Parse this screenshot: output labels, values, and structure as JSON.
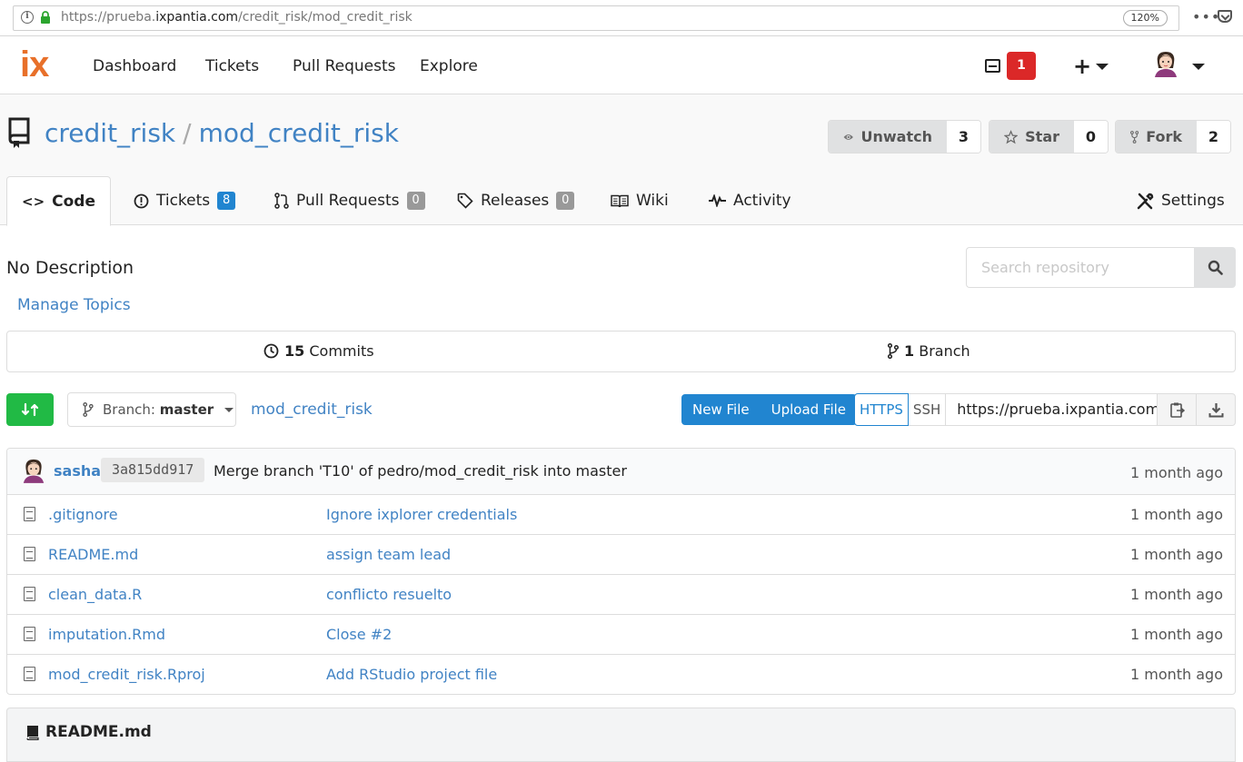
{
  "browser": {
    "url_prefix": "https://prueba.",
    "url_host": "ixpantia.com",
    "url_path": "/credit_risk/mod_credit_risk",
    "zoom": "120%"
  },
  "navbar": {
    "logo": "ix",
    "items": [
      "Dashboard",
      "Tickets",
      "Pull Requests",
      "Explore"
    ],
    "notifications": "1"
  },
  "repo": {
    "owner": "credit_risk",
    "separator": "/",
    "name": "mod_credit_risk",
    "watch_label": "Unwatch",
    "watch_count": "3",
    "star_label": "Star",
    "star_count": "0",
    "fork_label": "Fork",
    "fork_count": "2"
  },
  "tabs": {
    "code": "Code",
    "tickets": "Tickets",
    "tickets_count": "8",
    "pulls": "Pull Requests",
    "pulls_count": "0",
    "releases": "Releases",
    "releases_count": "0",
    "wiki": "Wiki",
    "activity": "Activity",
    "settings": "Settings"
  },
  "description": "No Description",
  "manage_topics": "Manage Topics",
  "search": {
    "placeholder": "Search repository"
  },
  "stats": {
    "commits_count": "15",
    "commits_label": "Commits",
    "branch_count": "1",
    "branch_label": "Branch"
  },
  "branch_bar": {
    "branch_prefix": "Branch:",
    "branch": "master",
    "breadcrumb": "mod_credit_risk",
    "new_file": "New File",
    "upload_file": "Upload File",
    "https": "HTTPS",
    "ssh": "SSH",
    "clone_url": "https://prueba.ixpantia.com/credit_risk/mod_credit_risk.git"
  },
  "latest_commit": {
    "user": "sasha",
    "sha": "3a815dd917",
    "message": "Merge branch 'T10' of pedro/mod_credit_risk into master",
    "time": "1 month ago"
  },
  "files": [
    {
      "name": ".gitignore",
      "commit": "Ignore ixplorer credentials",
      "time": "1 month ago"
    },
    {
      "name": "README.md",
      "commit": "assign team lead",
      "time": "1 month ago"
    },
    {
      "name": "clean_data.R",
      "commit": "conflicto resuelto",
      "time": "1 month ago"
    },
    {
      "name": "imputation.Rmd",
      "commit": "Close #2",
      "time": "1 month ago"
    },
    {
      "name": "mod_credit_risk.Rproj",
      "commit": "Add RStudio project file",
      "time": "1 month ago"
    }
  ],
  "readme": {
    "title": "README.md"
  },
  "colors": {
    "link": "#4183c4",
    "brand": "#e8702a",
    "primary": "#2185d0",
    "success": "#21ba45",
    "danger": "#db2828"
  }
}
